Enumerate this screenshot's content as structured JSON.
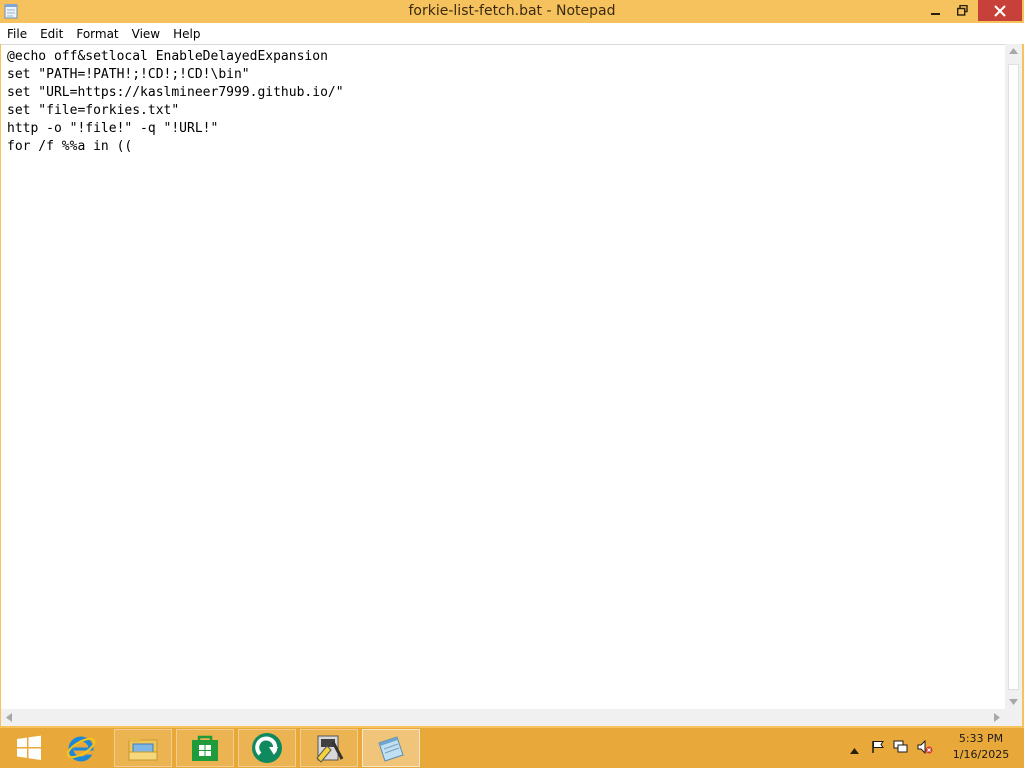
{
  "window": {
    "title": "forkie-list-fetch.bat - Notepad"
  },
  "menu": {
    "items": [
      "File",
      "Edit",
      "Format",
      "View",
      "Help"
    ]
  },
  "editor": {
    "content": "@echo off&setlocal EnableDelayedExpansion\nset \"PATH=!PATH!;!CD!;!CD!\\bin\"\nset \"URL=https://kaslmineer7999.github.io/\"\nset \"file=forkies.txt\"\nhttp -o \"!file!\" -q \"!URL!\"\nfor /f %%a in (("
  },
  "taskbar": {
    "items": [
      {
        "icon": "windows-start-icon"
      },
      {
        "icon": "internet-explorer-icon"
      },
      {
        "icon": "file-explorer-icon"
      },
      {
        "icon": "windows-store-icon"
      },
      {
        "icon": "green-circle-app-icon"
      },
      {
        "icon": "tools-app-icon"
      },
      {
        "icon": "notepad-icon"
      }
    ],
    "clock": {
      "time": "5:33 PM",
      "date": "1/16/2025"
    }
  },
  "colors": {
    "titlebar": "#f6c25e",
    "taskbar": "#e9a93a",
    "close_button": "#c7403a"
  }
}
